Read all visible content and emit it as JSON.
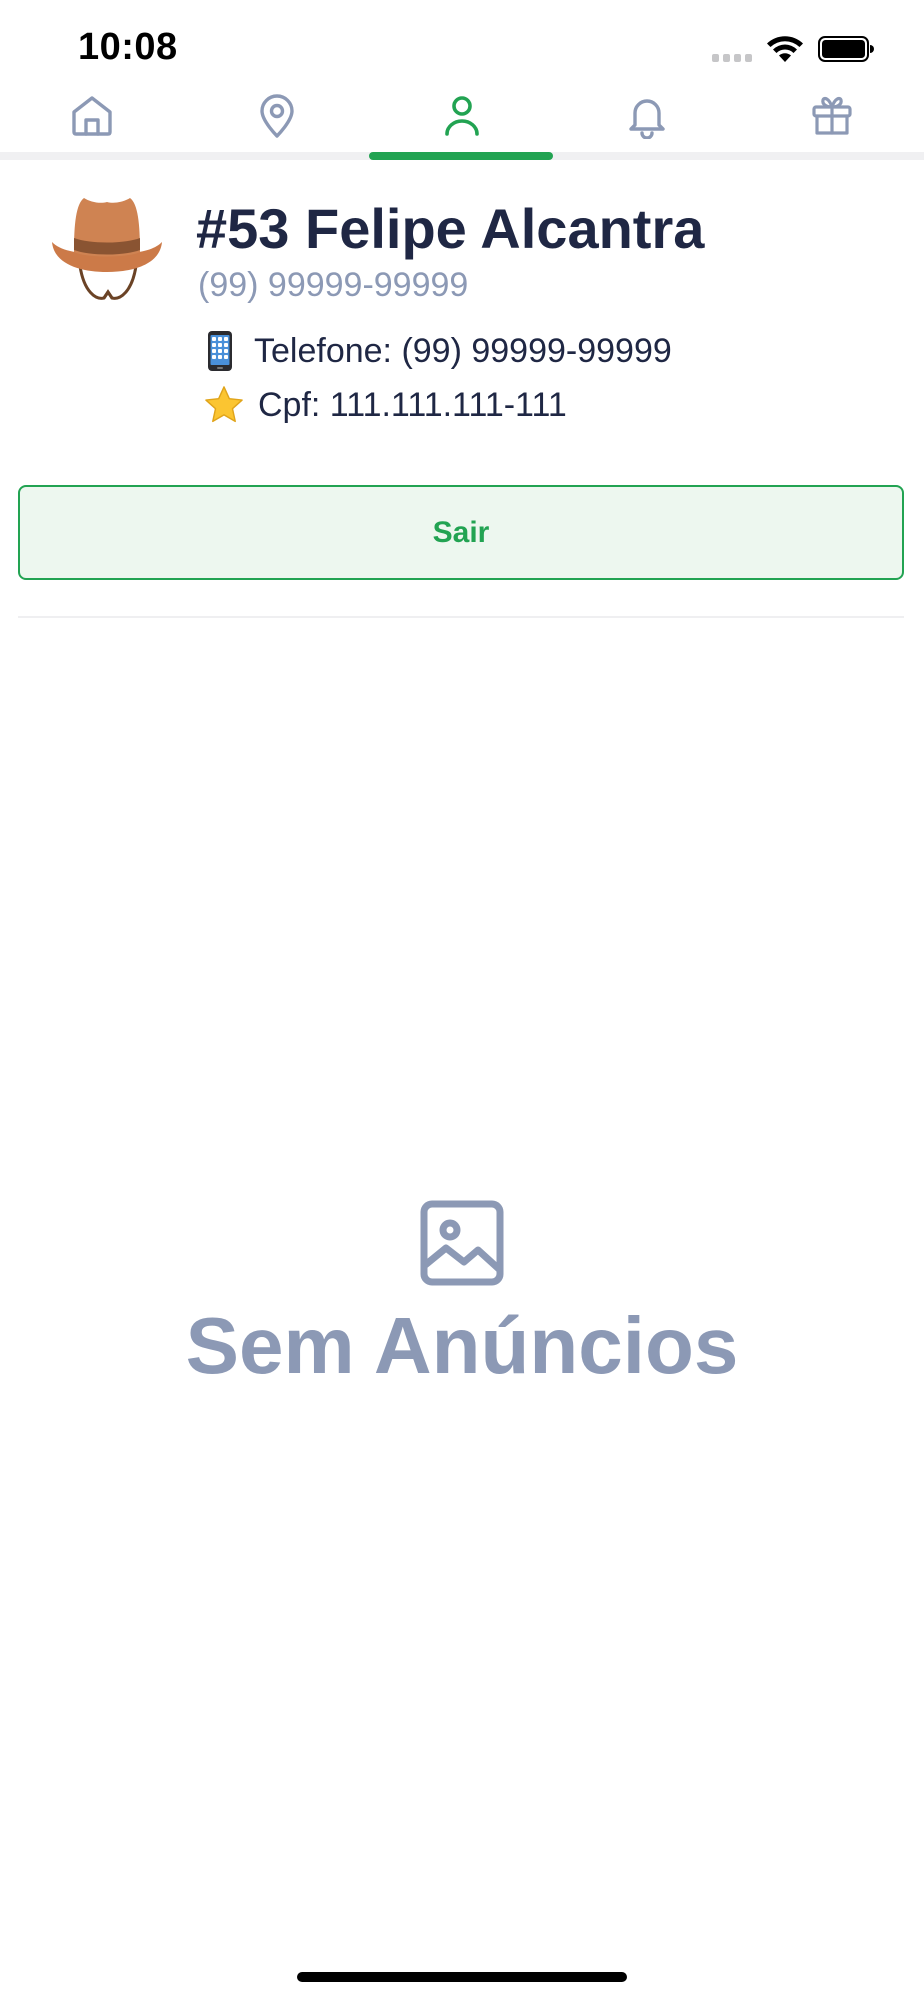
{
  "status_bar": {
    "time": "10:08"
  },
  "tabs": [
    {
      "name": "home",
      "icon": "home-icon",
      "active": false
    },
    {
      "name": "location",
      "icon": "map-pin-icon",
      "active": false
    },
    {
      "name": "profile",
      "icon": "user-icon",
      "active": true
    },
    {
      "name": "notifications",
      "icon": "bell-icon",
      "active": false
    },
    {
      "name": "rewards",
      "icon": "gift-icon",
      "active": false
    }
  ],
  "profile": {
    "avatar_icon": "cowboy-hat-icon",
    "name": "#53 Felipe Alcantra",
    "subtitle": "(99) 99999-99999",
    "phone_text": "Telefone: (99) 99999-99999",
    "phone_icon": "mobile-phone-icon",
    "cpf_text": "Cpf: 111.111.111-111",
    "cpf_icon": "star-icon"
  },
  "logout_button": {
    "label": "Sair"
  },
  "empty_state": {
    "icon": "image-icon",
    "title": "Sem Anúncios"
  },
  "colors": {
    "accent": "#22a352",
    "accent_bg": "#edf7ef",
    "text_dark": "#1f2744",
    "text_muted": "#8c99b5",
    "icon_inactive": "#8c99b5"
  }
}
